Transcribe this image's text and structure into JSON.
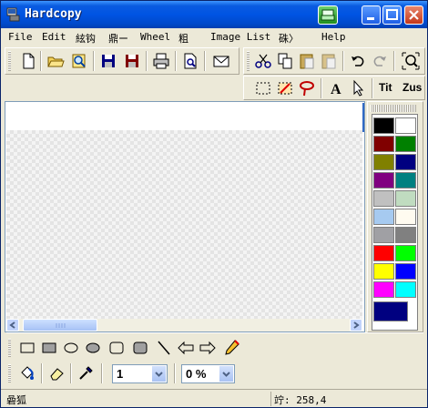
{
  "window": {
    "title": "Hardcopy"
  },
  "menu": {
    "items": [
      "File",
      "Edit",
      "絃钩",
      "鼎ー",
      "Wheel",
      "粗",
      "Image List",
      "硃〉",
      "Help"
    ]
  },
  "toolbar": {
    "icons": [
      "new-file-icon",
      "open-folder-icon",
      "browse-icon",
      "save-icon",
      "save-as-icon",
      "print-icon",
      "print-preview-icon",
      "email-icon",
      "cut-icon",
      "copy-icon",
      "paste-icon",
      "paste-special-icon",
      "undo-icon",
      "redo-icon",
      "zoom-fit-icon",
      "rect-select-icon",
      "crop-icon",
      "lasso-icon",
      "text-icon",
      "pointer-icon"
    ],
    "tit_label": "Tit",
    "zus_label": "Zus"
  },
  "palette": {
    "colors": [
      "#000000",
      "#ffffff",
      "#800000",
      "#008000",
      "#808000",
      "#000080",
      "#800080",
      "#008080",
      "#c0c0c0",
      "#c0dcc0",
      "#a6caf0",
      "#fffbf0",
      "#a0a0a4",
      "#808080",
      "#ff0000",
      "#00ff00",
      "#ffff00",
      "#0000ff",
      "#ff00ff",
      "#00ffff"
    ],
    "current": "#000080"
  },
  "drawing_tools": {
    "shapes": [
      "rectangle-icon",
      "filled-rectangle-icon",
      "ellipse-icon",
      "filled-ellipse-icon",
      "rounded-rect-icon",
      "filled-rounded-rect-icon",
      "line-icon",
      "arrow-left-icon",
      "arrow-right-icon",
      "pencil-icon"
    ],
    "line_width": "1",
    "opacity": "0 %"
  },
  "status": {
    "left": "碞狐",
    "right": "竚: 258,4"
  }
}
